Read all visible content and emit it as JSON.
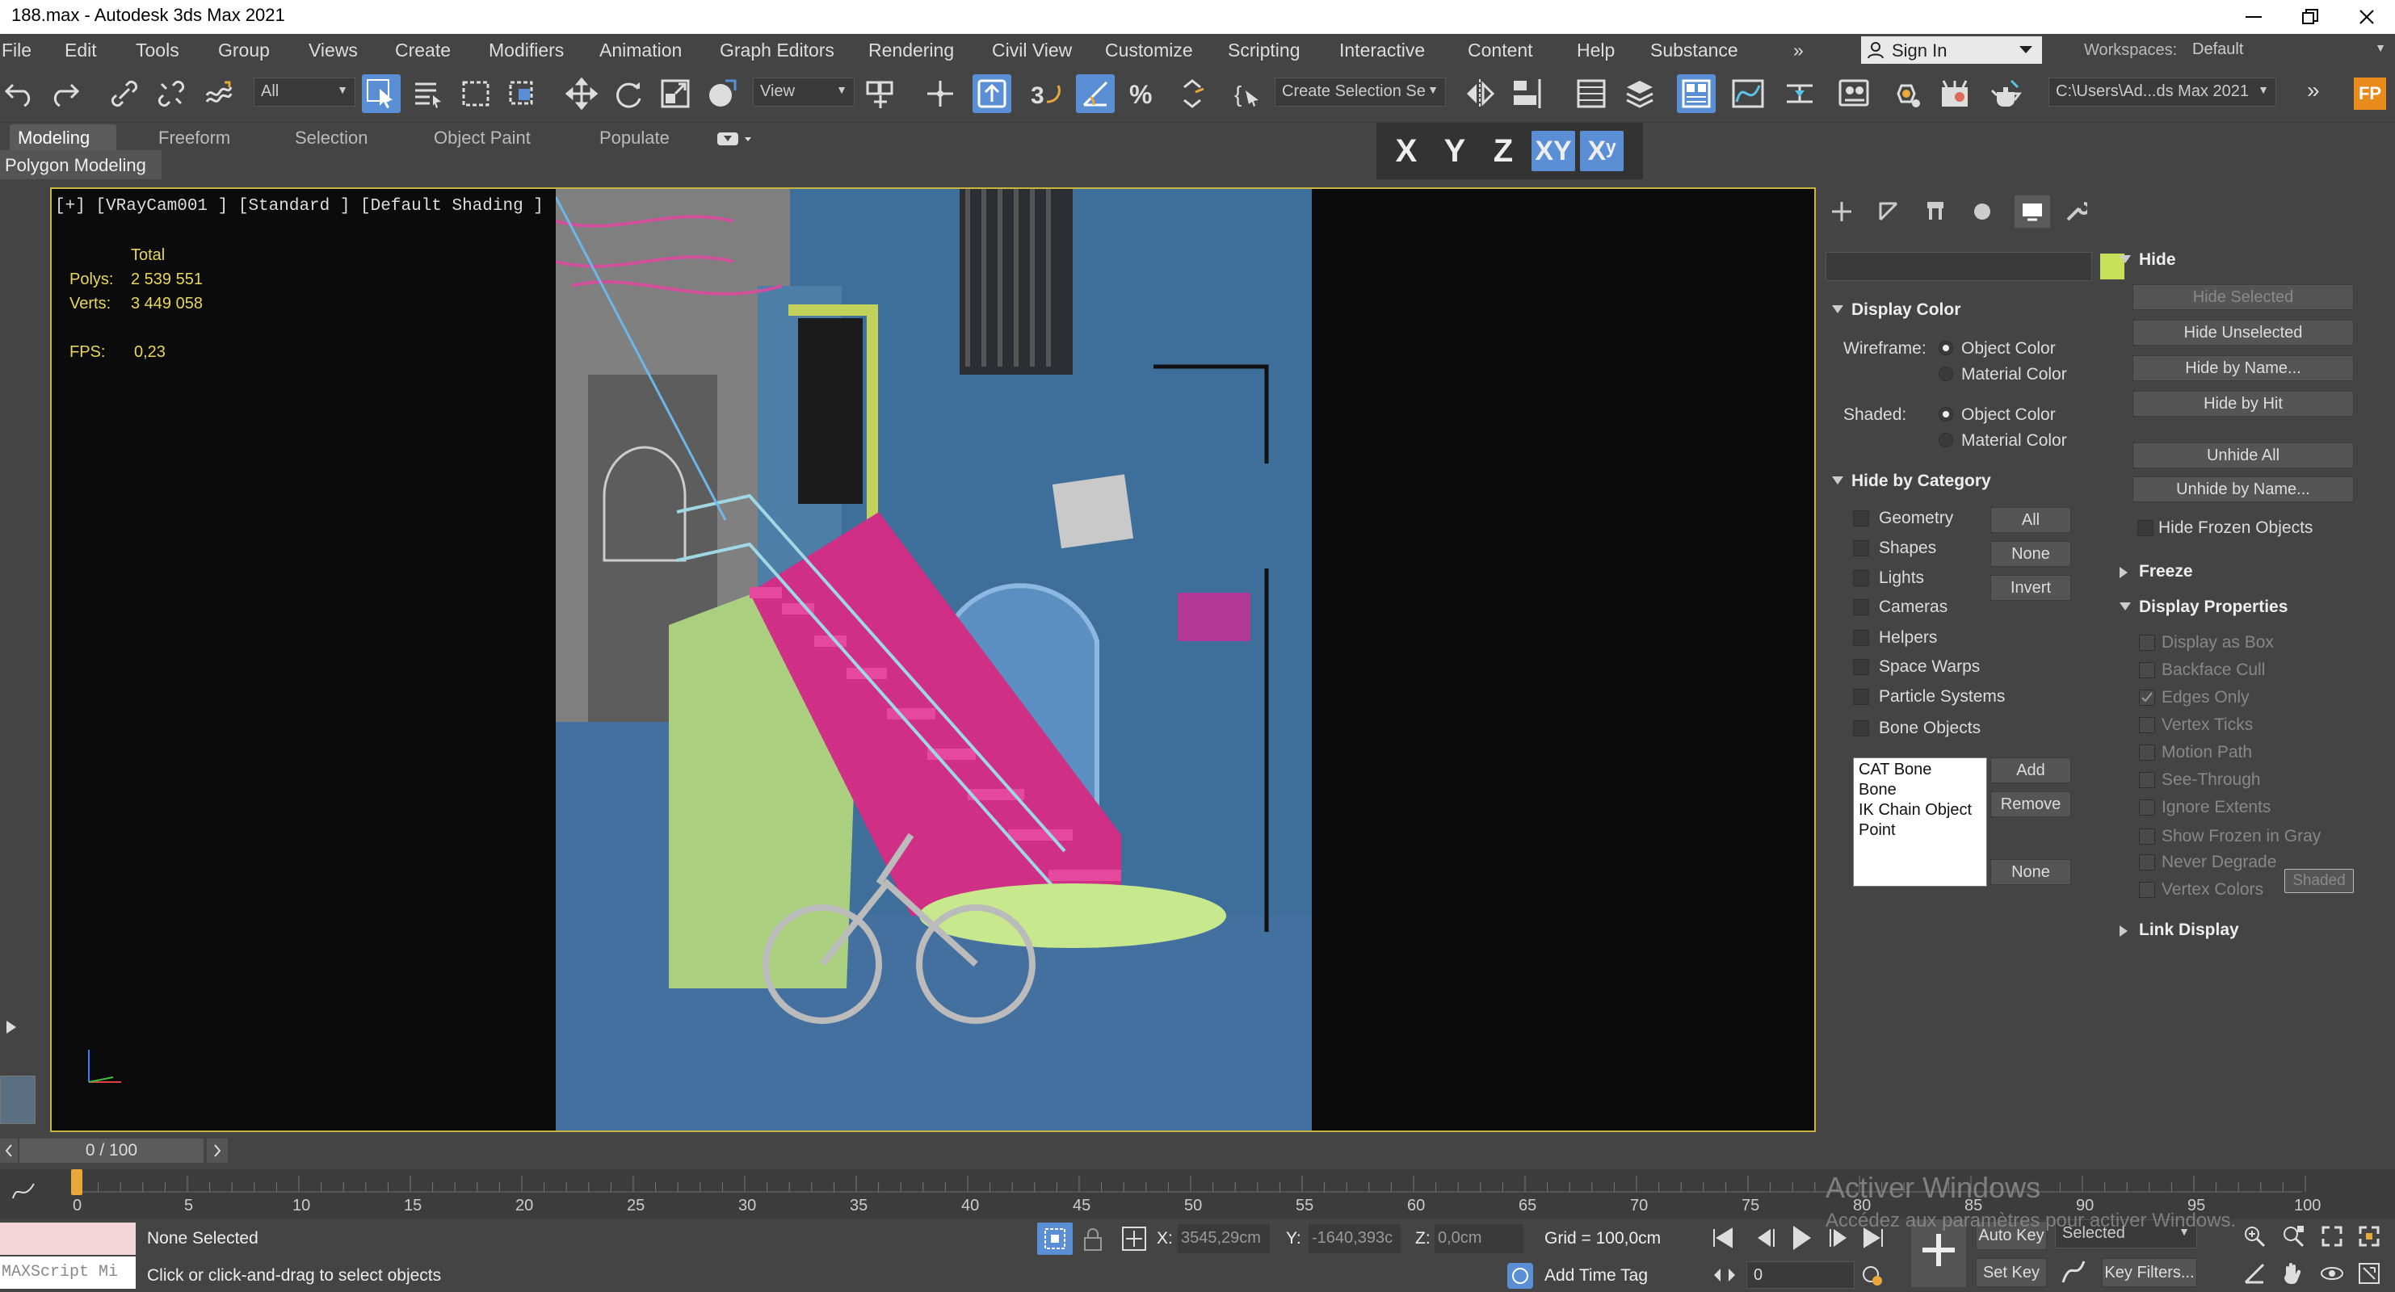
{
  "window": {
    "title": "188.max - Autodesk 3ds Max 2021",
    "minimize_icon": "minimize-icon",
    "maximize_icon": "restore-icon",
    "close_icon": "close-icon"
  },
  "menu": {
    "items": [
      "File",
      "Edit",
      "Tools",
      "Group",
      "Views",
      "Create",
      "Modifiers",
      "Animation",
      "Graph Editors",
      "Rendering",
      "Civil View",
      "Customize",
      "Scripting",
      "Interactive",
      "Content",
      "Help",
      "Substance"
    ],
    "more": "»",
    "sign_in": "Sign In",
    "workspaces_label": "Workspaces:",
    "workspace_value": "Default"
  },
  "toolbar": {
    "filter_value": "All",
    "refcoord_value": "View",
    "selection_set_value": "Create Selection Se",
    "path_value": "C:\\Users\\Ad...ds Max 2021",
    "more": "»",
    "fp": "FP"
  },
  "ribbon": {
    "tabs": [
      "Modeling",
      "Freeform",
      "Selection",
      "Object Paint",
      "Populate"
    ],
    "sub_label": "Polygon Modeling",
    "axes": [
      "X",
      "Y",
      "Z",
      "XY",
      "Xʸ"
    ]
  },
  "viewport": {
    "label": "[+] [VRayCam001 ] [Standard ] [Default Shading ]",
    "stats": {
      "total_label": "Total",
      "polys_label": "Polys:",
      "polys_value": "2 539 551",
      "verts_label": "Verts:",
      "verts_value": "3 449 058",
      "fps_label": "FPS:",
      "fps_value": "0,23"
    }
  },
  "panel": {
    "display_color": {
      "title": "Display Color",
      "wireframe_label": "Wireframe:",
      "shaded_label": "Shaded:",
      "object_color": "Object Color",
      "material_color": "Material Color"
    },
    "hide_by_category": {
      "title": "Hide by Category",
      "items": [
        "Geometry",
        "Shapes",
        "Lights",
        "Cameras",
        "Helpers",
        "Space Warps",
        "Particle Systems",
        "Bone Objects"
      ],
      "btn_all": "All",
      "btn_none": "None",
      "btn_invert": "Invert",
      "list": [
        "CAT Bone",
        "Bone",
        "IK Chain Object",
        "Point"
      ],
      "btn_add": "Add",
      "btn_remove": "Remove",
      "btn_none2": "None"
    },
    "hide": {
      "title": "Hide",
      "buttons": [
        "Hide Selected",
        "Hide Unselected",
        "Hide by Name...",
        "Hide by Hit",
        "Unhide All",
        "Unhide by Name..."
      ],
      "frozen_label": "Hide Frozen Objects"
    },
    "freeze": {
      "title": "Freeze"
    },
    "display_properties": {
      "title": "Display Properties",
      "items": [
        "Display as Box",
        "Backface Cull",
        "Edges Only",
        "Vertex Ticks",
        "Motion Path",
        "See-Through",
        "Ignore Extents",
        "Show Frozen in Gray",
        "Never Degrade",
        "Vertex Colors"
      ],
      "shaded_btn": "Shaded"
    },
    "link_display": {
      "title": "Link Display"
    }
  },
  "timeline": {
    "frame": "0 / 100",
    "ticks": [
      "0",
      "5",
      "10",
      "15",
      "20",
      "25",
      "30",
      "35",
      "40",
      "45",
      "50",
      "55",
      "60",
      "65",
      "70",
      "75",
      "80",
      "85",
      "90",
      "95",
      "100"
    ]
  },
  "status": {
    "maxscript": "MAXScript Mi",
    "selection": "None Selected",
    "prompt": "Click or click-and-drag to select objects",
    "x_label": "X:",
    "x_value": "3545,29cm",
    "y_label": "Y:",
    "y_value": "-1640,393c",
    "z_label": "Z:",
    "z_value": "0,0cm",
    "grid": "Grid = 100,0cm",
    "add_time_tag": "Add Time Tag",
    "auto_key": "Auto Key",
    "selected": "Selected",
    "set_key": "Set Key",
    "key_filters": "Key Filters...",
    "frame_value": "0",
    "watermark1": "Activer Windows",
    "watermark2": "Accédez aux paramètres pour activer Windows."
  }
}
